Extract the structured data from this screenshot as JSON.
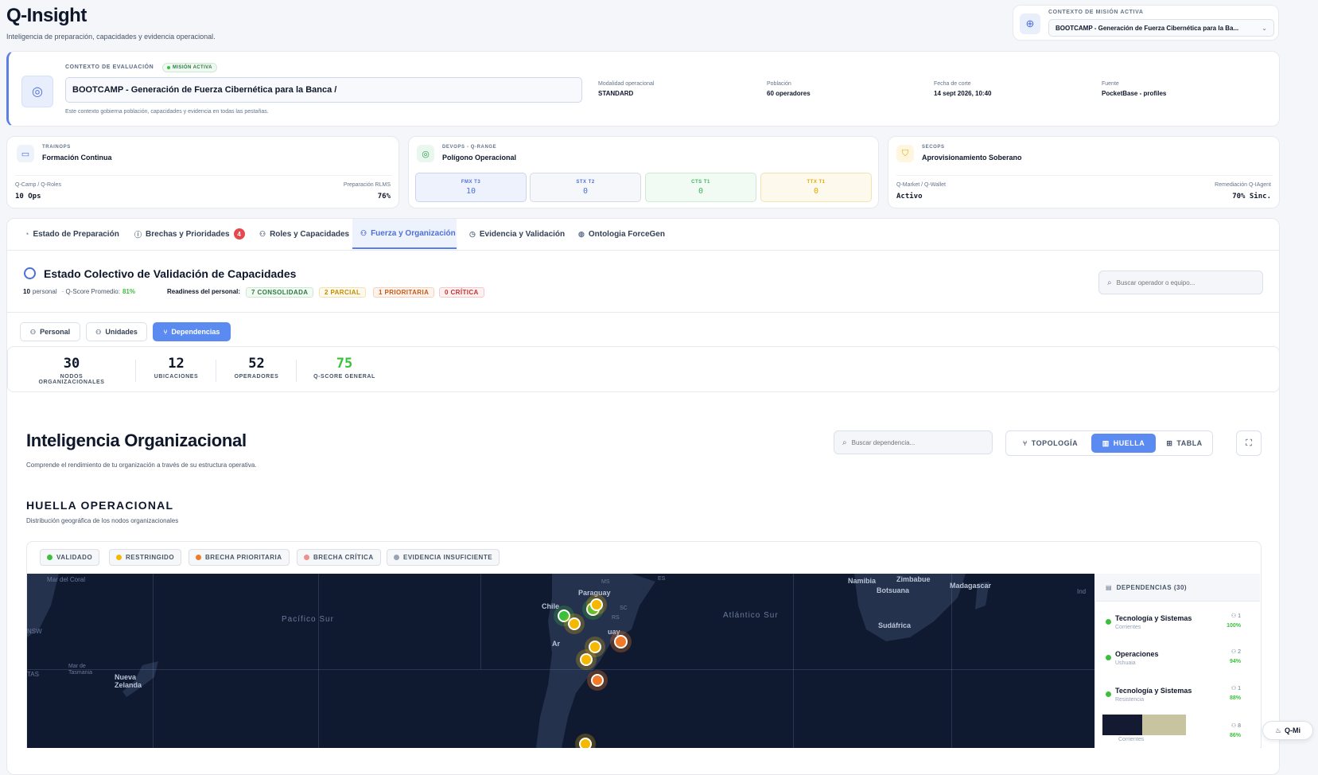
{
  "app": {
    "title": "Q-Insight",
    "subtitle": "Inteligencia de preparación, capacidades y evidencia operacional."
  },
  "mission_context": {
    "label": "CONTEXTO DE MISIÓN ACTIVA",
    "selected": "BOOTCAMP - Generación de Fuerza Cibernética para la Ba..."
  },
  "evaluation": {
    "label": "CONTEXTO DE EVALUACIÓN",
    "badge": "MISIÓN ACTIVA",
    "mission_value": "BOOTCAMP - Generación de Fuerza Cibernética para la Banca /",
    "note": "Este contexto gobierna población, capacidades y evidencia en todas las pestañas.",
    "fields": [
      {
        "label": "Modalidad operacional",
        "value": "STANDARD"
      },
      {
        "label": "Población",
        "value": "60 operadores"
      },
      {
        "label": "Fecha de corte",
        "value": "14 sept 2026, 10:40"
      },
      {
        "label": "Fuente",
        "value": "PocketBase - profiles"
      }
    ]
  },
  "ops_cards": {
    "trainops": {
      "cap": "TRAINOPS",
      "title": "Formación Continua",
      "left_label": "Q-Camp / Q-Roles",
      "left_value": "10 Ops",
      "right_label": "Preparación RLMS",
      "right_value": "76%"
    },
    "devops": {
      "cap": "DEVOPS - Q-RANGE",
      "title": "Polígono Operacional",
      "stats": [
        {
          "label": "FMX T3",
          "value": "10"
        },
        {
          "label": "STX T2",
          "value": "0"
        },
        {
          "label": "CTS T1",
          "value": "0"
        },
        {
          "label": "TTX T1",
          "value": "0"
        }
      ]
    },
    "secops": {
      "cap": "SECOPS",
      "title": "Aprovisionamiento Soberano",
      "left_label": "Q-Market / Q-Wallet",
      "left_value": "Activo",
      "right_label": "Remediación Q-IAgent",
      "right_value": "70% Sinc."
    }
  },
  "tabs": [
    {
      "label": "Estado de Preparación"
    },
    {
      "label": "Brechas y Prioridades",
      "badge": "4"
    },
    {
      "label": "Roles y Capacidades"
    },
    {
      "label": "Fuerza y Organización"
    },
    {
      "label": "Evidencia y Validación"
    },
    {
      "label": "Ontologia ForceGen"
    }
  ],
  "collective": {
    "title": "Estado Colectivo de Validación de Capacidades",
    "personal_count": "10",
    "personal_label": "personal",
    "qscore_label": "· Q-Score Promedio:",
    "qscore_value": "81%",
    "readiness_label": "Readiness del personal:",
    "chips": [
      "7 CONSOLIDADA",
      "2 PARCIAL",
      "1 PRIORITARIA",
      "0 CRÍTICA"
    ],
    "search_placeholder": "Buscar operador o equipo..."
  },
  "subtabs": [
    "Personal",
    "Unidades",
    "Dependencias"
  ],
  "kpis": [
    {
      "value": "30",
      "label": "NODOS ORGANIZACIONALES"
    },
    {
      "value": "12",
      "label": "UBICACIONES"
    },
    {
      "value": "52",
      "label": "OPERADORES"
    },
    {
      "value": "75",
      "label": "Q-SCORE GENERAL"
    }
  ],
  "org_intel": {
    "title": "Inteligencia Organizacional",
    "subtitle": "Comprende el rendimiento de tu organización a través de su estructura operativa.",
    "search_placeholder": "Buscar dependencia...",
    "views": [
      "TOPOLOGÍA",
      "HUELLA",
      "TABLA"
    ]
  },
  "huella": {
    "title": "HUELLA OPERACIONAL",
    "subtitle": "Distribución geográfica de los nodos organizacionales",
    "legend": [
      "VALIDADO",
      "RESTRINGIDO",
      "BRECHA PRIORITARIA",
      "BRECHA CRÍTICA",
      "EVIDENCIA INSUFICIENTE"
    ],
    "legend_colors": [
      "#3cbf3c",
      "#f5b800",
      "#f07a2a",
      "#f0908a",
      "#9aa3b2"
    ]
  },
  "map_labels": {
    "mar_del_coral": "Mar del Coral",
    "pacifico_sur": "Pacífico Sur",
    "atlantico_sur": "Atlántico Sur",
    "namibia": "Namibia",
    "zimbabue": "Zimbabue",
    "botsuana": "Botsuana",
    "madagascar": "Madagascar",
    "sudafrica": "Sudáfrica",
    "nueva_zelanda": "Nueva Zelanda",
    "mar_tasmania": "Mar de Tasmania",
    "paraguay": "Paraguay",
    "chile": "Chile",
    "uruguay": "uay",
    "argentina": "Ar",
    "tas": "TAS",
    "nsw": "NSW",
    "ms": "MS",
    "es": "ES",
    "sc": "SC",
    "rs": "RS",
    "ind": "Ind"
  },
  "dependencies": {
    "header": "DEPENDENCIAS (30)",
    "items": [
      {
        "name": "Tecnología y Sistemas",
        "sub": "Corrientes",
        "count": "1",
        "pct": "100%"
      },
      {
        "name": "Operaciones",
        "sub": "Ushuaia",
        "count": "2",
        "pct": "94%"
      },
      {
        "name": "Tecnología y Sistemas",
        "sub": "Resistencia",
        "count": "1",
        "pct": "88%"
      },
      {
        "name": "",
        "sub": "Corrientes",
        "count": "8",
        "pct": "86%"
      }
    ]
  },
  "assistant": {
    "label": "Q-Mi"
  }
}
